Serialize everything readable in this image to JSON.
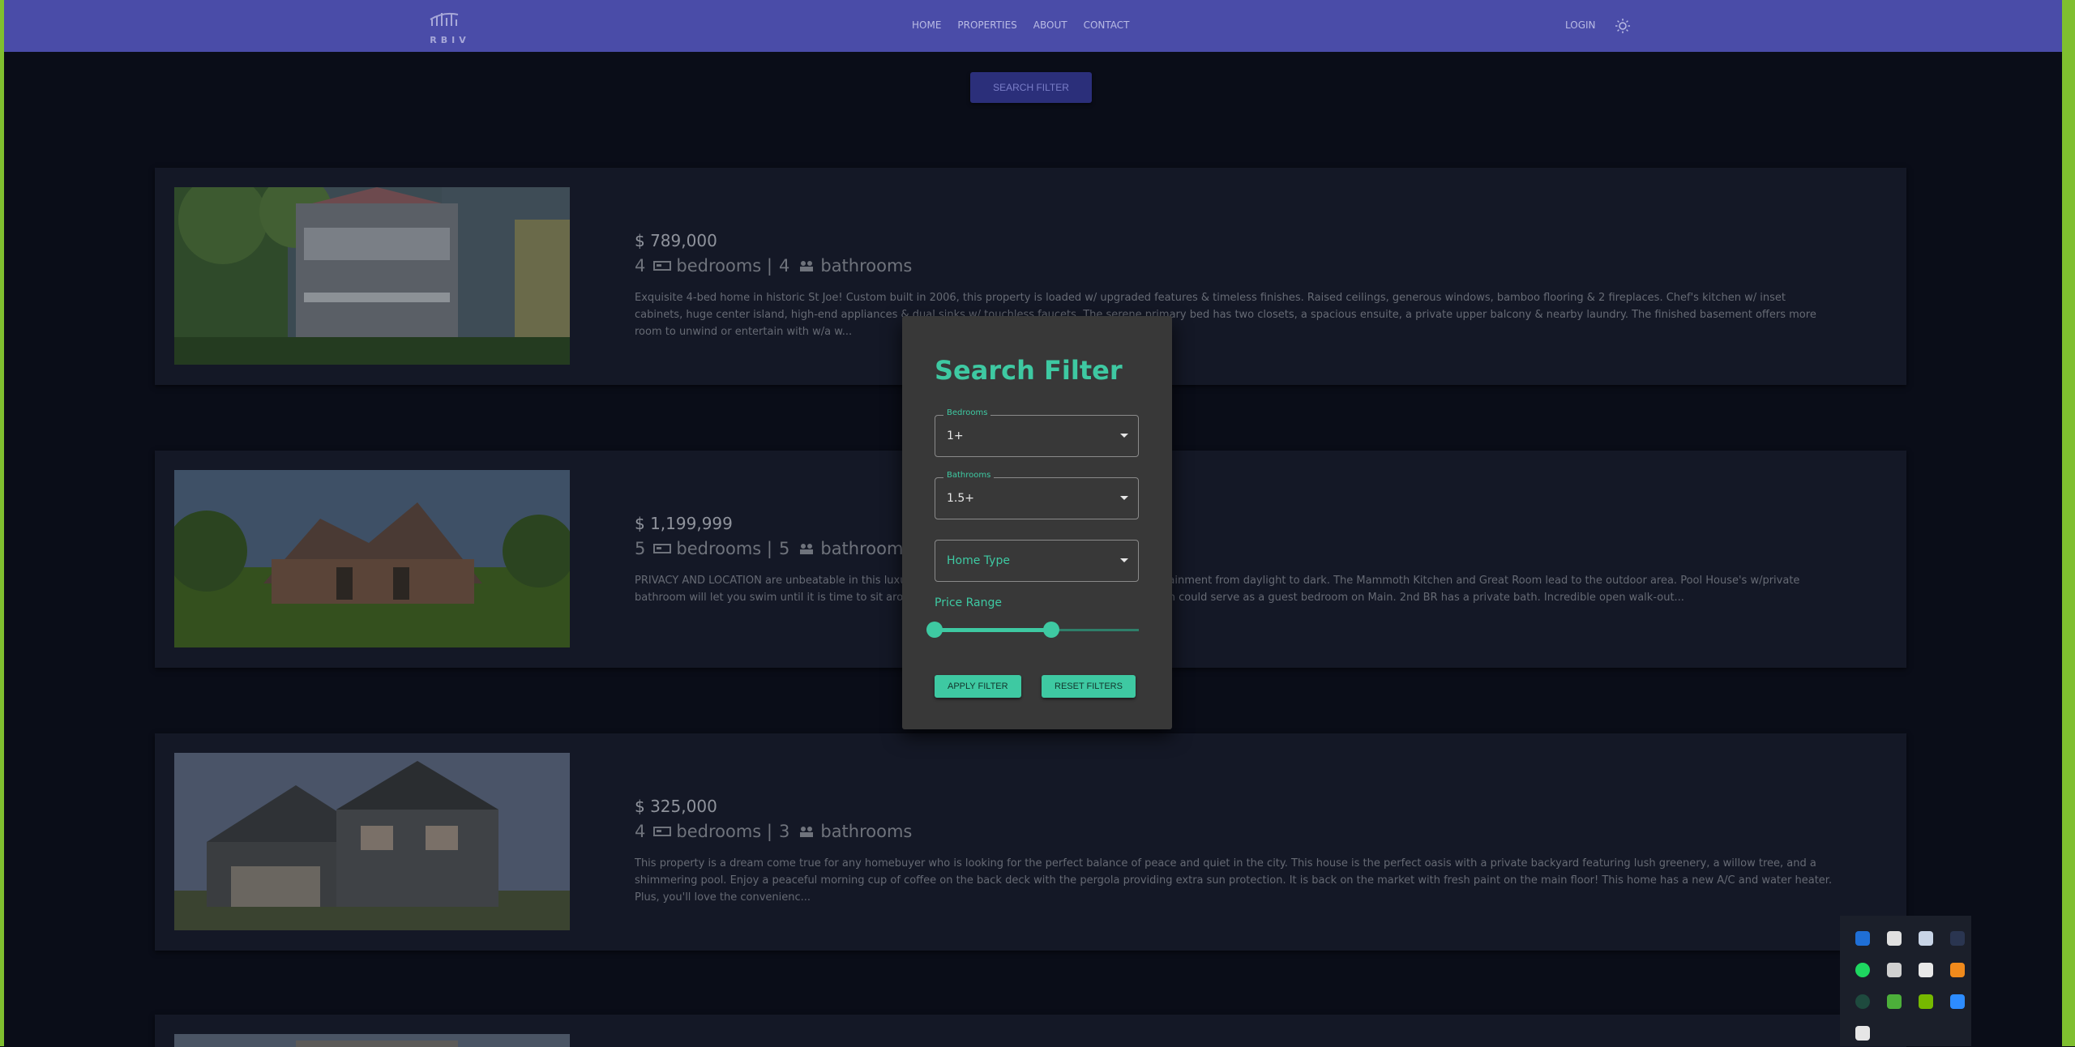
{
  "nav": {
    "logo_text": "RBIV",
    "links": [
      "HOME",
      "PROPERTIES",
      "ABOUT",
      "CONTACT"
    ],
    "login_label": "LOGIN"
  },
  "search_filter_button": "SEARCH FILTER",
  "listings": [
    {
      "price": "$ 789,000",
      "bedrooms": "4",
      "bathrooms": "4",
      "bedrooms_label": "bedrooms |",
      "bathrooms_label": "bathrooms",
      "description": "Exquisite 4-bed home in historic St Joe! Custom built in 2006, this property is loaded w/ upgraded features & timeless finishes. Raised ceilings, generous windows, bamboo flooring & 2 fireplaces. Chef's kitchen w/ inset cabinets, huge center island, high-end appliances & dual sinks w/ touchless faucets. The serene primary bed has two closets, a spacious ensuite, a private upper balcony & nearby laundry. The finished basement offers more room to unwind or entertain with w/a w..."
    },
    {
      "price": "$ 1,199,999",
      "bedrooms": "5",
      "bathrooms": "5",
      "bedrooms_label": "bedrooms |",
      "bathrooms_label": "bathrooms",
      "description": "PRIVACY AND LOCATION are unbeatable in this luxury home, offering endless opportunities for entertainment from daylight to dark. The Mammoth Kitchen and Great Room lead to the outdoor area. Pool House's w/private bathroom will let you swim until it is time to sit around the fire pit, roast dogs & gaze at the stars. Den could serve as a guest bedroom on Main. 2nd BR has a private bath. Incredible open walk-out..."
    },
    {
      "price": "$ 325,000",
      "bedrooms": "4",
      "bathrooms": "3",
      "bedrooms_label": "bedrooms |",
      "bathrooms_label": "bathrooms",
      "description": "This property is a dream come true for any homebuyer who is looking for the perfect balance of peace and quiet in the city. This house is the perfect oasis with a private backyard featuring lush greenery, a willow tree, and a shimmering pool. Enjoy a peaceful morning cup of coffee on the back deck with the pergola providing extra sun protection. It is back on the market with fresh paint on the main floor! This home has a new A/C and water heater. Plus, you'll love the convenienc..."
    }
  ],
  "modal": {
    "title": "Search Filter",
    "bedrooms_label": "Bedrooms",
    "bedrooms_value": "1+",
    "bathrooms_label": "Bathrooms",
    "bathrooms_value": "1.5+",
    "home_type_placeholder": "Home Type",
    "price_range_label": "Price Range",
    "price_range": {
      "low": 0.0,
      "high": 0.57
    },
    "apply_label": "APPLY FILTER",
    "reset_label": "RESET FILTERS"
  },
  "colors": {
    "accent": "#3ec9a2",
    "nav": "#4a4ca8",
    "background": "#0a0d18",
    "card": "#141826",
    "modal": "#383838"
  },
  "tray_icons": [
    "bluetooth-icon",
    "shield-icon",
    "steam-icon",
    "circle-app-icon",
    "spotify-icon",
    "copy-icon",
    "microphone-icon",
    "orange-app-icon",
    "ring-icon",
    "play-icon",
    "nvidia-icon",
    "zoom-icon",
    "grid-app-icon"
  ]
}
